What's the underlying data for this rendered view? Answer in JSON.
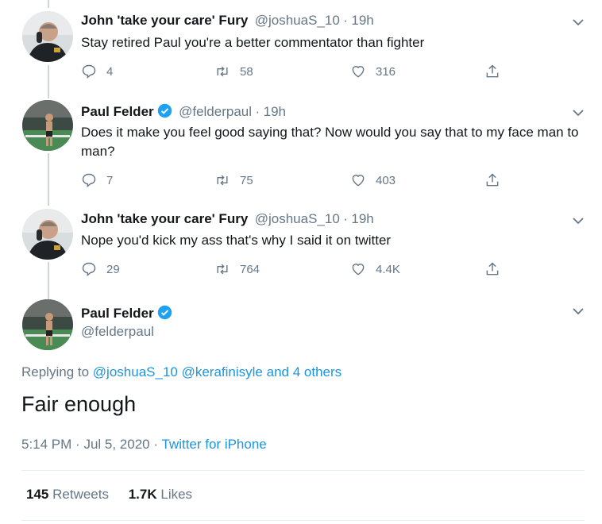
{
  "tweets": [
    {
      "name": "John 'take your care' Fury",
      "handle": "@joshuaS_10",
      "sep": "·",
      "time": "19h",
      "text": "Stay retired Paul you're a better commentator than fighter",
      "replies": "4",
      "retweets": "58",
      "likes": "316",
      "avatar_icon": "man-on-phone-photo"
    },
    {
      "name": "Paul Felder",
      "handle": "@felderpaul",
      "sep": "·",
      "time": "19h",
      "text": "Does it make you feel good saying that? Now would you say that to my face man to man?",
      "replies": "7",
      "retweets": "75",
      "likes": "403",
      "verified": true,
      "avatar_icon": "fighter-in-octagon-photo"
    },
    {
      "name": "John 'take your care' Fury",
      "handle": "@joshuaS_10",
      "sep": "·",
      "time": "19h",
      "text": "Nope you'd kick my ass that's why I said it on twitter",
      "replies": "29",
      "retweets": "764",
      "likes": "4.4K",
      "avatar_icon": "man-on-phone-photo"
    }
  ],
  "main_tweet": {
    "name": "Paul Felder",
    "handle": "@felderpaul",
    "replying_prefix": "Replying to",
    "replying_to_1": "@joshuaS_10",
    "replying_to_2": "@kerafinisyle",
    "replying_suffix": "and 4 others",
    "text": "Fair enough",
    "time": "5:14 PM",
    "date": "Jul 5, 2020",
    "sep": "·",
    "source": "Twitter for iPhone",
    "retweets_count": "145",
    "retweets_label": "Retweets",
    "likes_count": "1.7K",
    "likes_label": "Likes"
  },
  "colors": {
    "accent": "#1b95e0",
    "verified": "#1da1f2",
    "muted": "#657786",
    "divider": "#e6ecf0"
  }
}
